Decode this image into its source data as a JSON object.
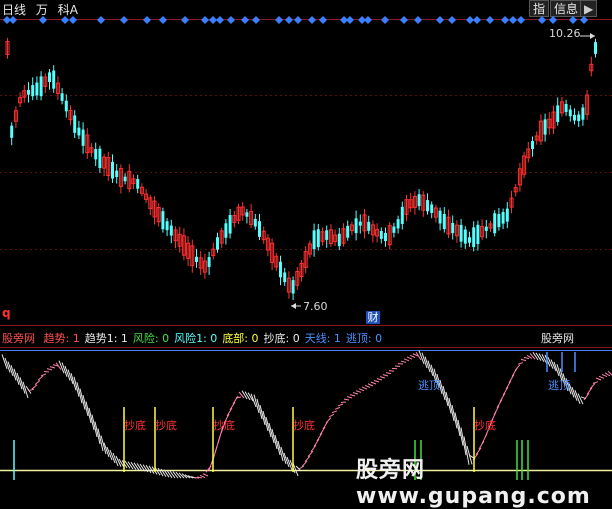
{
  "toolbar": {
    "period_label": "日线",
    "unit_label": "万",
    "fq_label": "科A",
    "btn_indicator": "指",
    "btn_info": "信息",
    "btn_expand": "▶"
  },
  "price_chart": {
    "high_label": "10.26",
    "low_label": "7.60",
    "ticker_mark": "q",
    "finance_badge": "财",
    "up_color": "#ff3030",
    "down_color": "#54ffff",
    "signal_color": "#3a7fff"
  },
  "indicator_header": {
    "source": "股旁网",
    "items": [
      {
        "text": "趋势: 1",
        "color": "#ff5050"
      },
      {
        "text": "趋势1: 1",
        "color": "#e8e8e8"
      },
      {
        "text": "风险: 0",
        "color": "#40e040"
      },
      {
        "text": "风险1: 0",
        "color": "#54ffff"
      },
      {
        "text": "底部: 0",
        "color": "#ffff40"
      },
      {
        "text": "抄底: 0",
        "color": "#e8e8e8"
      },
      {
        "text": "天线: 1",
        "color": "#4a90ff"
      },
      {
        "text": "逃顶: 0",
        "color": "#4a90ff"
      }
    ],
    "brand_box": "股旁网"
  },
  "indicator_panel": {
    "signals": [
      {
        "text": "抄底",
        "color": "#ff3030"
      },
      {
        "text": "抄底",
        "color": "#ff3030"
      },
      {
        "text": "抄底",
        "color": "#ff3030"
      },
      {
        "text": "抄底",
        "color": "#ff3030"
      },
      {
        "text": "抄底",
        "color": "#ff3030"
      },
      {
        "text": "逃顶",
        "color": "#4a90ff"
      },
      {
        "text": "逃顶",
        "color": "#4a90ff"
      }
    ]
  },
  "footer_watermark": "股旁网 www.gupang.com"
}
